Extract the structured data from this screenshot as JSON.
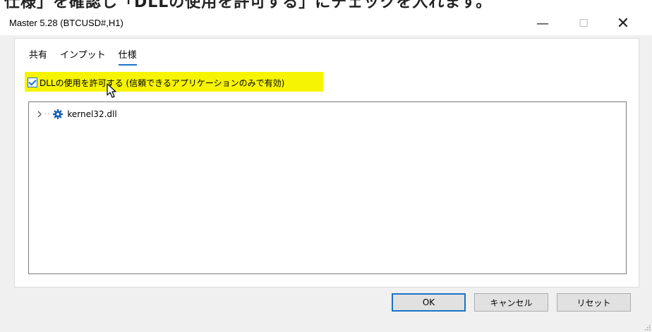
{
  "caption_fragment": "仕様」を確認し「DLLの使用を許可する」にチェックを入れます。",
  "window": {
    "title": "Master 5.28 (BTCUSD#,H1)",
    "minimize_glyph": "—",
    "maximize_glyph": "☐",
    "close_glyph": "✕"
  },
  "tabs": [
    {
      "label": "共有",
      "active": false
    },
    {
      "label": "インプット",
      "active": false
    },
    {
      "label": "仕様",
      "active": true
    }
  ],
  "dll_checkbox": {
    "label": "DLLの使用を許可する (信頼できるアプリケーションのみで有効)",
    "checked": true,
    "highlight_color": "#f6f400"
  },
  "tree": {
    "items": [
      {
        "label": "kernel32.dll",
        "icon": "gear-icon",
        "expanded": false
      }
    ]
  },
  "buttons": {
    "ok": "OK",
    "cancel": "キャンセル",
    "reset": "リセット"
  },
  "colors": {
    "accent": "#1a73c9",
    "dialog_bg": "#f0f0f0"
  }
}
